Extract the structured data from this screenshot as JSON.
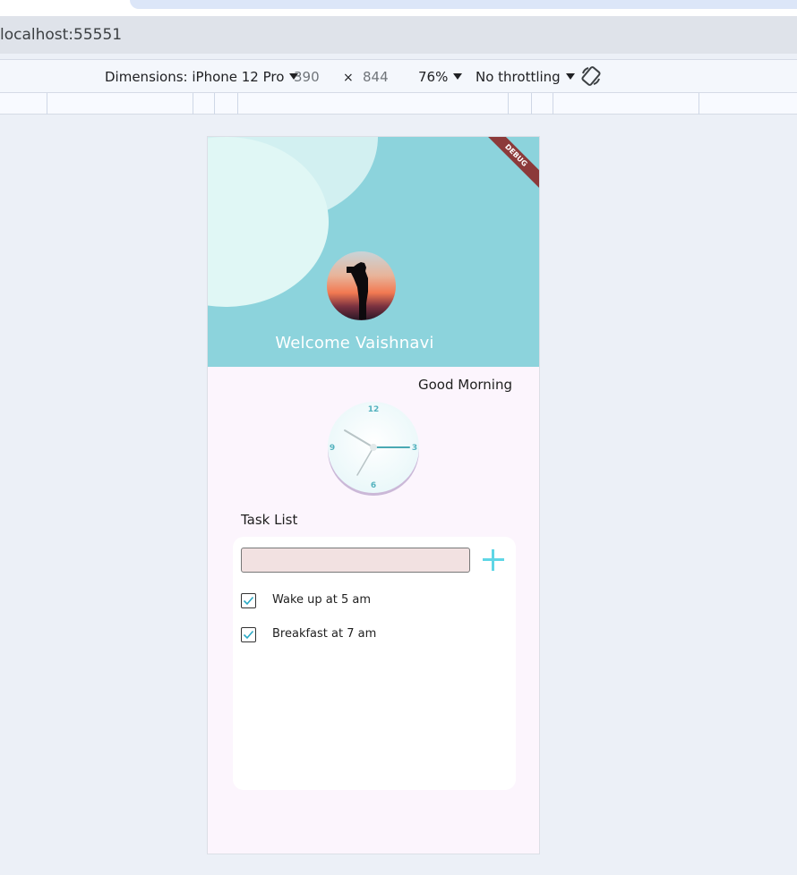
{
  "browser": {
    "url": "localhost:55551"
  },
  "devtools": {
    "dimensions_label": "Dimensions: iPhone 12 Pro",
    "width": "390",
    "times": "×",
    "height": "844",
    "zoom": "76%",
    "throttling": "No throttling"
  },
  "app": {
    "debug_banner": "DEBUG",
    "welcome": "Welcome Vaishnavi",
    "greeting": "Good Morning",
    "clock": {
      "numerals": [
        "12",
        "3",
        "6",
        "9"
      ],
      "hour_hand": "10",
      "minute_hand": "15",
      "second_hand": "35"
    },
    "task_list_title": "Task List",
    "task_input": {
      "value": "",
      "placeholder": ""
    },
    "tasks": [
      {
        "label": "Wake up at 5 am",
        "checked": true
      },
      {
        "label": "Breakfast at 7 am",
        "checked": true
      }
    ],
    "colors": {
      "header": "#8cd3dc",
      "accent": "#5fd6e6",
      "background": "#fcf5fd",
      "input": "#f2e1e1"
    }
  }
}
